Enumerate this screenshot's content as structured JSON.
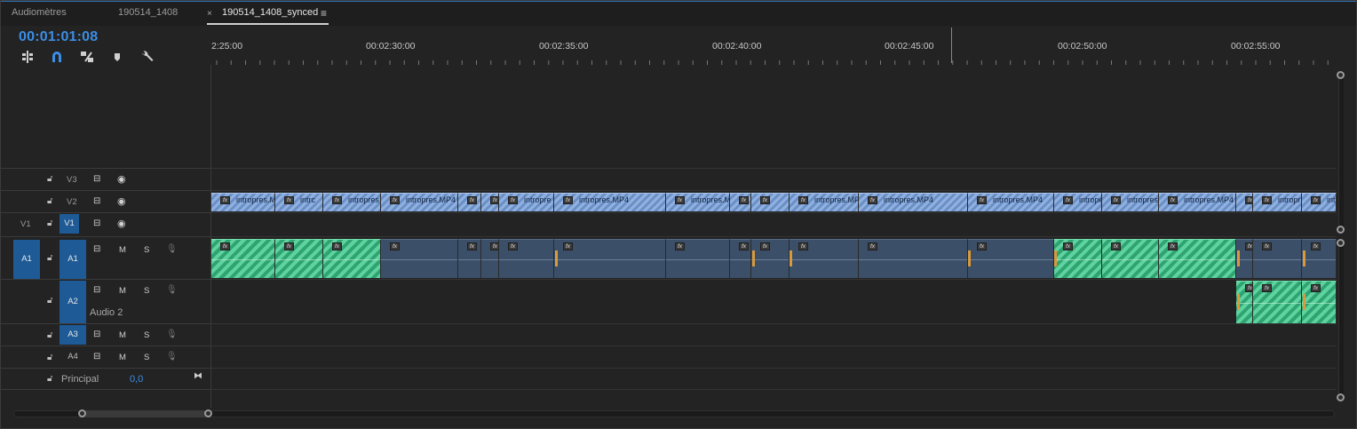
{
  "tabs": [
    {
      "label": "Audiomètres"
    },
    {
      "label": "190514_1408"
    },
    {
      "label": "190514_1408_synced"
    }
  ],
  "active_tab_index": 2,
  "tab_close_glyph": "×",
  "tab_menu_glyph": "≡",
  "timecode": "00:01:01:08",
  "toolbar": {
    "icons": [
      "insert-overwrite-icon",
      "snap-icon",
      "linked-selection-icon",
      "add-marker-icon",
      "settings-wrench-icon"
    ]
  },
  "ruler": {
    "labels": [
      "2:25:00",
      "00:02:30:00",
      "00:02:35:00",
      "00:02:40:00",
      "00:02:45:00",
      "00:02:50:00",
      "00:02:55:00"
    ]
  },
  "tracks": {
    "v3": {
      "label": "V3"
    },
    "v2": {
      "label": "V2"
    },
    "v1": {
      "label": "V1",
      "source": "V1"
    },
    "a1": {
      "label": "A1",
      "source": "A1",
      "m": "M",
      "s": "S"
    },
    "a2": {
      "label": "A2",
      "name": "Audio 2",
      "m": "M",
      "s": "S"
    },
    "a3": {
      "label": "A3",
      "m": "M",
      "s": "S"
    },
    "a4": {
      "label": "A4",
      "m": "M",
      "s": "S"
    },
    "master": {
      "name": "Principal",
      "value": "0,0"
    }
  },
  "clips": {
    "v2": [
      {
        "label": "intropres.M"
      },
      {
        "label": "intrc"
      },
      {
        "label": "intropres"
      },
      {
        "label": "intropres.MP4"
      },
      {
        "label": ""
      },
      {
        "label": ""
      },
      {
        "label": "intropre"
      },
      {
        "label": "intropres.MP4"
      },
      {
        "label": "intropres.M"
      },
      {
        "label": ""
      },
      {
        "label": ""
      },
      {
        "label": "intropres.MP"
      },
      {
        "label": "intropres.MP4"
      },
      {
        "label": "intropres.MP4"
      },
      {
        "label": "intrope"
      },
      {
        "label": "intropres"
      },
      {
        "label": "intropres.MP4"
      },
      {
        "label": ""
      },
      {
        "label": "intropres"
      },
      {
        "label": "intr"
      }
    ],
    "fx_badge": "fx"
  },
  "colors": {
    "accent": "#3b8ee6",
    "video_clip": "#8aaadf",
    "audio_clip_green": "#3fbf85",
    "audio_clip_blue": "#3b4f68",
    "marker": "#d89a3c"
  }
}
